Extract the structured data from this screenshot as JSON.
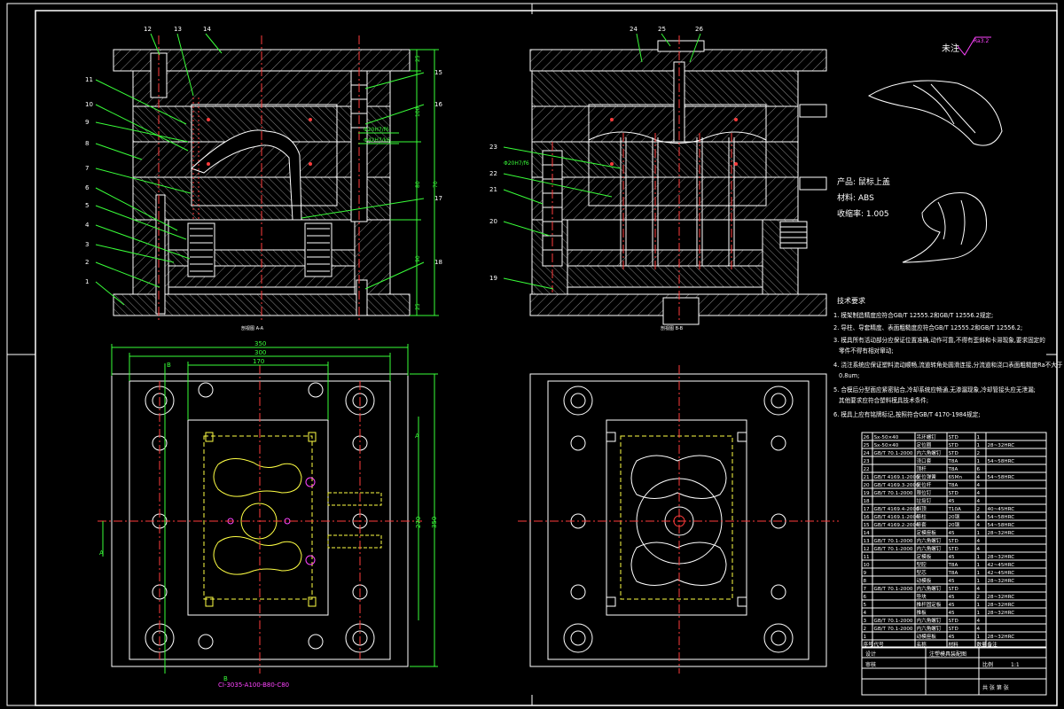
{
  "colors": {
    "background": "#000000",
    "frame": "#ffffff",
    "outline": "#ffffff",
    "hatch": "#9a9a9a",
    "centerline": "#ff3b3b",
    "dimension": "#39ff39",
    "leader": "#39ff39",
    "cavity": "#ffff44",
    "text": "#ffffff",
    "insert": "#ff44ff"
  },
  "section_a": {
    "caption": "剖视图 A-A",
    "balloons": [
      "12",
      "13",
      "14",
      "15",
      "16",
      "17",
      "18",
      "1",
      "2",
      "3",
      "4",
      "5",
      "6",
      "7",
      "8",
      "9",
      "10",
      "11"
    ],
    "fits": [
      "Φ20H7/f6",
      "Φ42H7/k6"
    ],
    "dims": [
      "25",
      "100",
      "70",
      "80",
      "90",
      "25"
    ]
  },
  "section_b": {
    "caption": "剖视图 B-B",
    "balloons": [
      "24",
      "25",
      "26",
      "23",
      "22",
      "21",
      "20",
      "19"
    ],
    "fits": [
      "Φ20H7/f6"
    ]
  },
  "plan_view": {
    "dims": [
      "350",
      "300",
      "170",
      "B",
      "A",
      "270",
      "350",
      "A",
      "B"
    ],
    "plate_code": "CI-3035-A100-B80-C80"
  },
  "product": {
    "roughness_label": "未注",
    "roughness_value": "Ra3.2",
    "name_line": "产品: 鼠标上盖",
    "material_line": "材料: ABS",
    "shrink_line": "收缩率: 1.005"
  },
  "notes": {
    "title": "技术要求",
    "items": [
      "1. 模架制造精度应符合GB/T 12555.2和GB/T 12556.2规定;",
      "2. 导柱、导套精度、表面粗糙度应符合GB/T 12555.2和GB/T 12556.2;",
      "3. 模具所有活动部分应保证位置准确,动作可靠,不得有歪斜和卡滞现象,要求固定的",
      "   零件不得有相对窜动;",
      "4. 浇注系统应保证塑料流动顺畅,流道转角处圆滑连接,分流道和浇口表面粗糙度Ra不大于",
      "   0.8um;",
      "5. 合模后分型面应紧密贴合,冷却系统应畅通,无渗漏现象,冷却管接头应无泄漏;",
      "   其他要求应符合塑料模具技术条件;",
      "6. 模具上应有铭牌标记,按照符合GB/T 4170-1984规定;"
    ]
  },
  "bom": {
    "rows": [
      [
        "26",
        "Sx-50×40",
        "吊环螺钉",
        "STD",
        "1",
        ""
      ],
      [
        "25",
        "Sx-50×40",
        "定位圈",
        "STD",
        "1",
        "28~32HRC"
      ],
      [
        "24",
        "GB/T 70.1-2000",
        "内六角螺钉",
        "STD",
        "2",
        ""
      ],
      [
        "23",
        "",
        "浇口套",
        "T8A",
        "1",
        "54~58HRC"
      ],
      [
        "22",
        "",
        "顶杆",
        "T8A",
        "6",
        ""
      ],
      [
        "21",
        "GB/T 4169.1-2006",
        "复位弹簧",
        "65Mn",
        "4",
        "54~58HRC"
      ],
      [
        "20",
        "GB/T 4169.3-2006",
        "复位杆",
        "T8A",
        "4",
        ""
      ],
      [
        "19",
        "GB/T 70.1-2000",
        "限位钉",
        "STD",
        "4",
        ""
      ],
      [
        "18",
        "",
        "垃圾钉",
        "45",
        "4",
        ""
      ],
      [
        "17",
        "GB/T 4169.4-2006",
        "斜顶",
        "T10A",
        "2",
        "40~45HRC"
      ],
      [
        "16",
        "GB/T 4169.1-2006",
        "导柱",
        "20钢",
        "4",
        "54~58HRC"
      ],
      [
        "15",
        "GB/T 4169.2-2006",
        "导套",
        "20钢",
        "4",
        "54~58HRC"
      ],
      [
        "14",
        "",
        "定模座板",
        "45",
        "1",
        "28~32HRC"
      ],
      [
        "13",
        "GB/T 70.1-2000",
        "内六角螺钉",
        "STD",
        "4",
        ""
      ],
      [
        "12",
        "GB/T 70.1-2000",
        "内六角螺钉",
        "STD",
        "4",
        ""
      ],
      [
        "11",
        "",
        "定模板",
        "45",
        "1",
        "28~32HRC"
      ],
      [
        "10",
        "",
        "型腔",
        "T8A",
        "1",
        "42~45HRC"
      ],
      [
        "9",
        "",
        "型芯",
        "T8A",
        "1",
        "42~45HRC"
      ],
      [
        "8",
        "",
        "动模板",
        "45",
        "1",
        "28~32HRC"
      ],
      [
        "7",
        "GB/T 70.1-2000",
        "内六角螺钉",
        "STD",
        "4",
        ""
      ],
      [
        "6",
        "",
        "垫块",
        "45",
        "2",
        "28~32HRC"
      ],
      [
        "5",
        "",
        "推杆固定板",
        "45",
        "1",
        "28~32HRC"
      ],
      [
        "4",
        "",
        "推板",
        "45",
        "1",
        "28~32HRC"
      ],
      [
        "3",
        "GB/T 70.1-2000",
        "内六角螺钉",
        "STD",
        "4",
        ""
      ],
      [
        "2",
        "GB/T 70.1-2000",
        "内六角螺钉",
        "STD",
        "4",
        ""
      ],
      [
        "1",
        "",
        "动模座板",
        "45",
        "1",
        "28~32HRC"
      ]
    ],
    "header": [
      "序号",
      "代号",
      "名称",
      "材料",
      "数量",
      "备注"
    ],
    "title_block": {
      "drawing_name": "注塑模具装配图",
      "label_design": "设计",
      "label_check": "审核",
      "label_scale": "比例",
      "label_sheet": "共 张 第 张",
      "scale_value": "1:1"
    }
  }
}
